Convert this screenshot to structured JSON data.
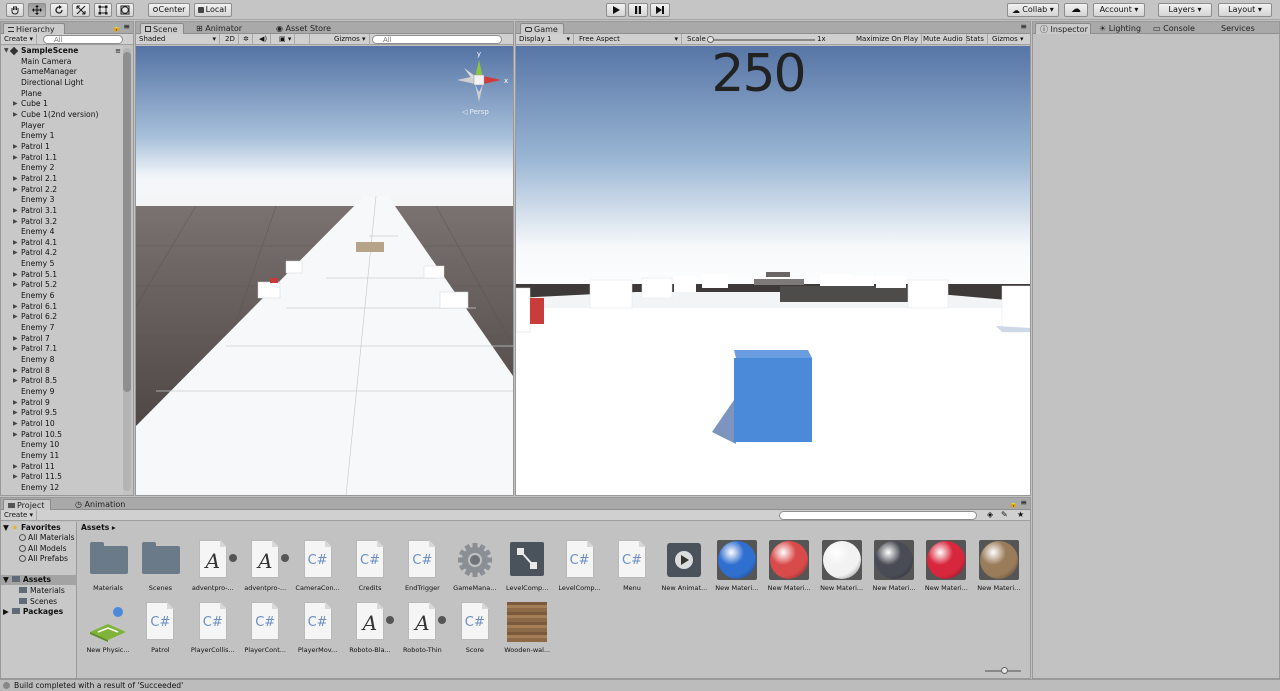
{
  "toolbar": {
    "tools": [
      "hand-tool-icon",
      "move-tool-icon",
      "rotate-tool-icon",
      "scale-tool-icon",
      "rect-tool-icon",
      "transform-tool-icon"
    ],
    "pivot_label": "Center",
    "space_label": "Local",
    "collab_label": "Collab ▾",
    "account_label": "Account ▾",
    "layers_label": "Layers ▾",
    "layout_label": "Layout ▾"
  },
  "hierarchy": {
    "tab_label": "Hierarchy",
    "create_label": "Create ▾",
    "search_placeholder": "All",
    "scene_name": "SampleScene",
    "items": [
      {
        "label": "Main Camera",
        "arrow": false
      },
      {
        "label": "GameManager",
        "arrow": false
      },
      {
        "label": "Directional Light",
        "arrow": false
      },
      {
        "label": "Plane",
        "arrow": false
      },
      {
        "label": "Cube 1",
        "arrow": true
      },
      {
        "label": "Cube 1(2nd version)",
        "arrow": true
      },
      {
        "label": "Player",
        "arrow": false
      },
      {
        "label": "Enemy 1",
        "arrow": false
      },
      {
        "label": "Patrol 1",
        "arrow": true
      },
      {
        "label": "Patrol 1.1",
        "arrow": true
      },
      {
        "label": "Enemy 2",
        "arrow": false
      },
      {
        "label": "Patrol 2.1",
        "arrow": true
      },
      {
        "label": "Patrol 2.2",
        "arrow": true
      },
      {
        "label": "Enemy 3",
        "arrow": false
      },
      {
        "label": "Patrol 3.1",
        "arrow": true
      },
      {
        "label": "Patrol 3.2",
        "arrow": true
      },
      {
        "label": "Enemy 4",
        "arrow": false
      },
      {
        "label": "Patrol 4.1",
        "arrow": true
      },
      {
        "label": "Patrol 4.2",
        "arrow": true
      },
      {
        "label": "Enemy 5",
        "arrow": false
      },
      {
        "label": "Patrol 5.1",
        "arrow": true
      },
      {
        "label": "Patrol 5.2",
        "arrow": true
      },
      {
        "label": "Enemy 6",
        "arrow": false
      },
      {
        "label": "Patrol 6.1",
        "arrow": true
      },
      {
        "label": "Patrol 6.2",
        "arrow": true
      },
      {
        "label": "Enemy 7",
        "arrow": false
      },
      {
        "label": "Patrol 7",
        "arrow": true
      },
      {
        "label": "Patrol 7.1",
        "arrow": true
      },
      {
        "label": "Enemy 8",
        "arrow": false
      },
      {
        "label": "Patrol 8",
        "arrow": true
      },
      {
        "label": "Patrol 8.5",
        "arrow": true
      },
      {
        "label": "Enemy 9",
        "arrow": false
      },
      {
        "label": "Patrol 9",
        "arrow": true
      },
      {
        "label": "Patrol 9.5",
        "arrow": true
      },
      {
        "label": "Patrol 10",
        "arrow": true
      },
      {
        "label": "Patrol 10.5",
        "arrow": true
      },
      {
        "label": "Enemy 10",
        "arrow": false
      },
      {
        "label": "Enemy 11",
        "arrow": false
      },
      {
        "label": "Patrol 11",
        "arrow": true
      },
      {
        "label": "Patrol 11.5",
        "arrow": true
      },
      {
        "label": "Enemy 12",
        "arrow": false
      }
    ]
  },
  "scene": {
    "tabs": [
      "Scene",
      "Animator",
      "Asset Store"
    ],
    "shading_label": "Shaded",
    "mode_2d_label": "2D",
    "gizmos_label": "Gizmos ▾",
    "search_placeholder": "All",
    "persp_label": "◁ Persp",
    "gizmo_axes": {
      "y": "y",
      "x": "x"
    }
  },
  "game": {
    "tab_label": "Game",
    "display_label": "Display 1",
    "aspect_label": "Free Aspect",
    "scale_label": "Scale",
    "scale_value": "1x",
    "maximize_label": "Maximize On Play",
    "mute_label": "Mute Audio",
    "stats_label": "Stats",
    "gizmos_label": "Gizmos ▾",
    "score": "250"
  },
  "inspector": {
    "tabs": [
      "Inspector",
      "Lighting",
      "Console",
      "Services"
    ]
  },
  "project": {
    "tabs": [
      "Project",
      "Animation"
    ],
    "create_label": "Create ▾",
    "breadcrumb": "Assets ▸",
    "favorites_label": "Favorites",
    "favorites": [
      "All Materials",
      "All Models",
      "All Prefabs"
    ],
    "assets_label": "Assets",
    "asset_folders": [
      "Materials",
      "Scenes"
    ],
    "packages_label": "Packages",
    "assets_row1": [
      {
        "name": "Materials",
        "kind": "folder"
      },
      {
        "name": "Scenes",
        "kind": "folder"
      },
      {
        "name": "adventpro-...",
        "kind": "font"
      },
      {
        "name": "adventpro-...",
        "kind": "font"
      },
      {
        "name": "CameraCon...",
        "kind": "script"
      },
      {
        "name": "Credits",
        "kind": "script"
      },
      {
        "name": "EndTrigger",
        "kind": "script"
      },
      {
        "name": "GameMana...",
        "kind": "gear"
      },
      {
        "name": "LevelComp...",
        "kind": "anim"
      },
      {
        "name": "LevelComp...",
        "kind": "script"
      },
      {
        "name": "Menu",
        "kind": "script"
      },
      {
        "name": "New Animat...",
        "kind": "animclip"
      },
      {
        "name": "New Materi...",
        "kind": "material",
        "color": "#2f6fd0"
      },
      {
        "name": "New Materi...",
        "kind": "material",
        "color": "#d94a4a"
      },
      {
        "name": "New Materi...",
        "kind": "material",
        "color": "#f2f2f2"
      },
      {
        "name": "New Materi...",
        "kind": "material",
        "color": "#4a4c55"
      },
      {
        "name": "New Materi...",
        "kind": "material",
        "color": "#d8263c"
      },
      {
        "name": "New Materi...",
        "kind": "material",
        "color": "#9a7b5a"
      }
    ],
    "assets_row2": [
      {
        "name": "New Physic...",
        "kind": "physic"
      },
      {
        "name": "Patrol",
        "kind": "script"
      },
      {
        "name": "PlayerCollis...",
        "kind": "script"
      },
      {
        "name": "PlayerCont...",
        "kind": "script"
      },
      {
        "name": "PlayerMov...",
        "kind": "script"
      },
      {
        "name": "Roboto-Bla...",
        "kind": "font"
      },
      {
        "name": "Roboto-Thin",
        "kind": "font"
      },
      {
        "name": "Score",
        "kind": "script"
      },
      {
        "name": "Wooden-wal...",
        "kind": "texture"
      }
    ],
    "script_glyph": "C#",
    "font_glyph": "A"
  },
  "status": {
    "message": "Build completed with a result of 'Succeeded'"
  }
}
